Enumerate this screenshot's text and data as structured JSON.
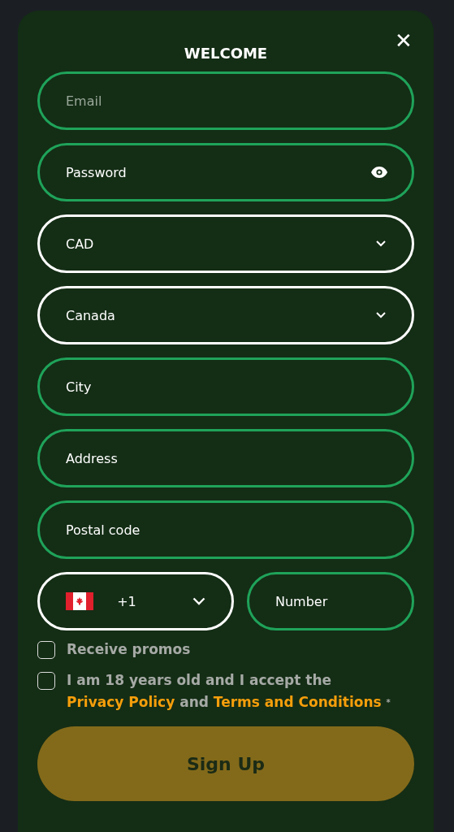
{
  "dialog": {
    "title": "WELCOME",
    "close": "✕"
  },
  "fields": [
    {
      "kind": "text",
      "placeholder": "Email"
    },
    {
      "kind": "password",
      "label": "Password"
    },
    {
      "kind": "select",
      "label": "CAD"
    },
    {
      "kind": "select",
      "label": "Canada"
    },
    {
      "kind": "label",
      "label": "City"
    },
    {
      "kind": "label",
      "label": "Address"
    },
    {
      "kind": "label",
      "label": "Postal code"
    }
  ],
  "phone": {
    "code": "+1",
    "number_label": "Number"
  },
  "checkboxes": [
    {
      "checked": false,
      "parts": [
        {
          "kind": "text",
          "text": "Receive promos"
        }
      ]
    },
    {
      "checked": false,
      "parts": [
        {
          "kind": "text",
          "text": "I am 18 years old and I accept the"
        },
        {
          "kind": "link",
          "text": "Privacy Policy"
        },
        {
          "kind": "text",
          "text": "and"
        },
        {
          "kind": "link",
          "text": "Terms and Conditions"
        },
        {
          "kind": "mark",
          "text": "*"
        }
      ]
    }
  ],
  "submit": {
    "label": "Sign Up",
    "disabled": true
  }
}
